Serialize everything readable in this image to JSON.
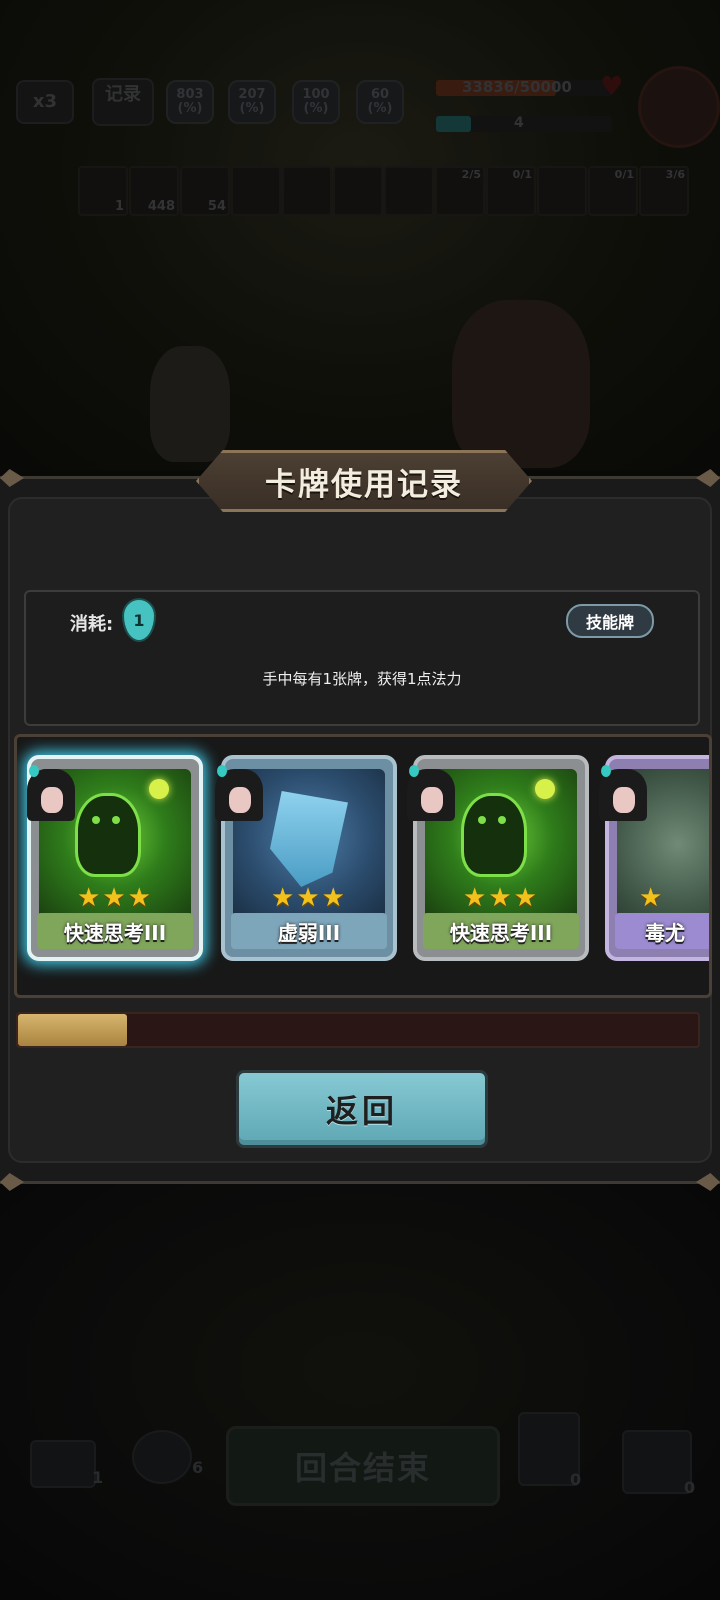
{
  "hud": {
    "speed_label": "x3",
    "record_label": "记录",
    "stats": [
      {
        "value": "803",
        "unit": "(%)"
      },
      {
        "value": "207",
        "unit": "(%)"
      },
      {
        "value": "100",
        "unit": "(%)"
      },
      {
        "value": "60",
        "unit": "(%)"
      }
    ],
    "hp_text": "33836/50000",
    "hp_fraction": 0.68,
    "mana_text": "4",
    "relics": [
      {
        "count": "1",
        "top": ""
      },
      {
        "count": "448",
        "top": ""
      },
      {
        "count": "54",
        "top": ""
      },
      {
        "count": "",
        "top": ""
      },
      {
        "count": "",
        "top": ""
      },
      {
        "count": "",
        "top": ""
      },
      {
        "count": "",
        "top": ""
      },
      {
        "count": "",
        "top": "2/5"
      },
      {
        "count": "",
        "top": "0/1"
      },
      {
        "count": "",
        "top": ""
      },
      {
        "count": "",
        "top": "0/1"
      },
      {
        "count": "",
        "top": "3/6"
      }
    ]
  },
  "modal": {
    "title": "卡牌使用记录",
    "cost_label": "消耗:",
    "cost_value": "1",
    "card_type": "技能牌",
    "description": "手中每有1张牌，获得1点法力",
    "cards": [
      {
        "name": "快速思考III",
        "stars": "★★★",
        "theme": "green",
        "selected": true
      },
      {
        "name": "虚弱III",
        "stars": "★★★",
        "theme": "blue",
        "selected": false
      },
      {
        "name": "快速思考III",
        "stars": "★★★",
        "theme": "green",
        "selected": false
      },
      {
        "name": "毒尤",
        "stars": "★",
        "theme": "purple",
        "selected": false
      }
    ],
    "scroll_progress": 0.16,
    "back_label": "返回"
  },
  "bottom_hud": {
    "draw_pile_count": "1",
    "energy_count": "6",
    "end_turn_label": "回合结束",
    "potion_count": "0",
    "discard_count": "0"
  },
  "colors": {
    "accent_cyan": "#46c3c0",
    "card_select_glow": "#3ec3e0",
    "button_teal": "#86c9d3",
    "progress_gold": "#d8b56e",
    "banner_brown": "#4c3f33"
  }
}
